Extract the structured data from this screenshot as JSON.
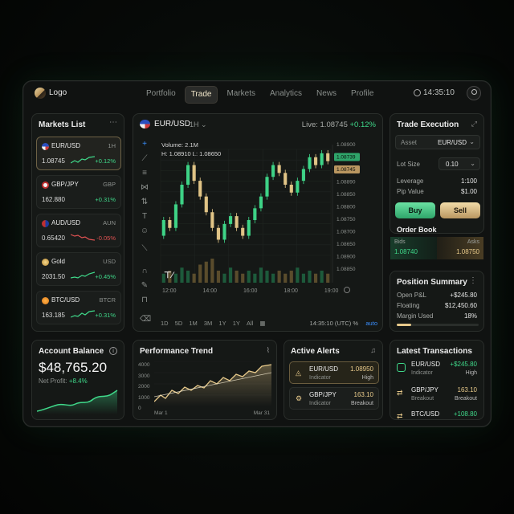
{
  "header": {
    "logo_text": "Logo",
    "nav": [
      "Portfolio",
      "Trade",
      "Markets",
      "Analytics",
      "News",
      "Profile"
    ],
    "active_nav": "Trade",
    "clock": "14:35:10"
  },
  "markets": {
    "title": "Markets List",
    "items": [
      {
        "name": "EUR/USD",
        "tf": "1H",
        "price": "1.08745",
        "change": "+0.12%",
        "dir": "up",
        "icon": "us-flag-icon"
      },
      {
        "name": "GBP/JPY",
        "tf": "GBP",
        "price": "162.880",
        "change": "+0.31%",
        "dir": "up",
        "icon": "gbp-jpy-icon"
      },
      {
        "name": "AUD/USD",
        "tf": "AUN",
        "price": "0.65420",
        "change": "-0.05%",
        "dir": "down",
        "icon": "aud-flag-icon"
      },
      {
        "name": "Gold",
        "tf": "USD",
        "price": "2031.50",
        "change": "+0.45%",
        "dir": "up",
        "icon": "gold-coin-icon"
      },
      {
        "name": "BTC/USD",
        "tf": "BTCR",
        "price": "163.185",
        "change": "+0.31%",
        "dir": "up",
        "icon": "bitcoin-icon"
      }
    ]
  },
  "chart": {
    "pair": "EUR/USD",
    "tf": "1H",
    "live_label": "Live:",
    "live_price": "1.08745",
    "live_change": "+0.12%",
    "volume": "Volume: 2.1M",
    "hl": "H: 1.08910   L: 1.08650",
    "price_ticks": [
      "1.08900",
      "1.08739",
      "1.08745",
      "1.08890",
      "1.08850",
      "1.08800",
      "1.08750",
      "1.08700",
      "1.08650",
      "1.08900",
      "1.08850"
    ],
    "time_ticks": [
      "12:00",
      "14:00",
      "16:00",
      "18:00",
      "19:00"
    ],
    "timeframes": [
      "1D",
      "5D",
      "1M",
      "3M",
      "1Y",
      "1Y",
      "All"
    ],
    "timestamp": "14:35:10 (UTC) %",
    "auto": "auto"
  },
  "chart_data": {
    "type": "bar",
    "title": "EUR/USD",
    "candles": [
      {
        "o": 1.087,
        "c": 1.0874
      },
      {
        "o": 1.0874,
        "c": 1.0872
      },
      {
        "o": 1.0872,
        "c": 1.0878
      },
      {
        "o": 1.0878,
        "c": 1.0883
      },
      {
        "o": 1.0883,
        "c": 1.0888
      },
      {
        "o": 1.0888,
        "c": 1.0884
      },
      {
        "o": 1.0884,
        "c": 1.088
      },
      {
        "o": 1.088,
        "c": 1.0876
      },
      {
        "o": 1.0876,
        "c": 1.0872
      },
      {
        "o": 1.0872,
        "c": 1.0869
      },
      {
        "o": 1.0869,
        "c": 1.0873
      },
      {
        "o": 1.0873,
        "c": 1.0875
      },
      {
        "o": 1.0875,
        "c": 1.0872
      },
      {
        "o": 1.0872,
        "c": 1.087
      },
      {
        "o": 1.087,
        "c": 1.0874
      },
      {
        "o": 1.0874,
        "c": 1.0877
      },
      {
        "o": 1.0877,
        "c": 1.088
      },
      {
        "o": 1.088,
        "c": 1.0885
      },
      {
        "o": 1.0885,
        "c": 1.0888
      },
      {
        "o": 1.0888,
        "c": 1.0886
      },
      {
        "o": 1.0886,
        "c": 1.0883
      },
      {
        "o": 1.0883,
        "c": 1.0881
      },
      {
        "o": 1.0881,
        "c": 1.0884
      },
      {
        "o": 1.0884,
        "c": 1.0887
      },
      {
        "o": 1.0887,
        "c": 1.089
      },
      {
        "o": 1.089,
        "c": 1.0888
      },
      {
        "o": 1.0888,
        "c": 1.0891
      },
      {
        "o": 1.0891,
        "c": 1.0889
      }
    ],
    "volumes": [
      3,
      4,
      3,
      5,
      4,
      3,
      6,
      7,
      8,
      4,
      3,
      5,
      4,
      3,
      4,
      3,
      5,
      4,
      3,
      4,
      3,
      4,
      5,
      3,
      4,
      3,
      4,
      3
    ],
    "ylim": [
      1.0865,
      1.0892
    ]
  },
  "trade": {
    "title": "Trade Execution",
    "asset_label": "Asset",
    "asset_value": "EUR/USD",
    "lot_label": "Lot Size",
    "lot_value": "0.10",
    "lev_label": "Leverage",
    "lev_value": "1:100",
    "pip_label": "Pip Value",
    "pip_value": "$1.00",
    "buy": "Buy",
    "sell": "Sell",
    "book_title": "Order Book",
    "bids_label": "Bids",
    "asks_label": "Asks",
    "bid_price": "1.08740",
    "ask_price": "1.08750"
  },
  "position": {
    "title": "Position Summary",
    "open_label": "Open P&L",
    "open_value": "+$245.80",
    "float_label": "Floating",
    "float_value": "$12,450.60",
    "margin_label": "Margin Used",
    "margin_value": "18%",
    "margin_pct": 0.18
  },
  "balance": {
    "title": "Account Balance",
    "amount": "$48,765.20",
    "profit_label": "Net Profit:",
    "profit_value": "+8.4%"
  },
  "performance": {
    "title": "Performance Trend",
    "y_ticks": [
      "4000",
      "3000",
      "2000",
      "1000",
      "0"
    ],
    "x_ticks": [
      "Mar 1",
      "Mar 31"
    ]
  },
  "alerts": {
    "title": "Active Alerts",
    "items": [
      {
        "pair": "EUR/USD",
        "type": "Indicator",
        "value": "1.08950",
        "level": "High"
      },
      {
        "pair": "GBP/JPY",
        "type": "Indicator",
        "value": "163.10",
        "level": "Breakout"
      }
    ]
  },
  "transactions": {
    "title": "Latest Transactions",
    "items": [
      {
        "pair": "EUR/USD",
        "type": "Indicator",
        "amount": "+$245.80",
        "level": "High"
      },
      {
        "pair": "GBP/JPY",
        "type": "Breakout",
        "amount": "163.10",
        "level": "Breakout"
      },
      {
        "pair": "BTC/USD",
        "type": "",
        "amount": "+108.80",
        "level": ""
      }
    ]
  },
  "colors": {
    "up": "#3fd98a",
    "down": "#e05252",
    "gold": "#e7c98a",
    "bg": "#101211"
  }
}
